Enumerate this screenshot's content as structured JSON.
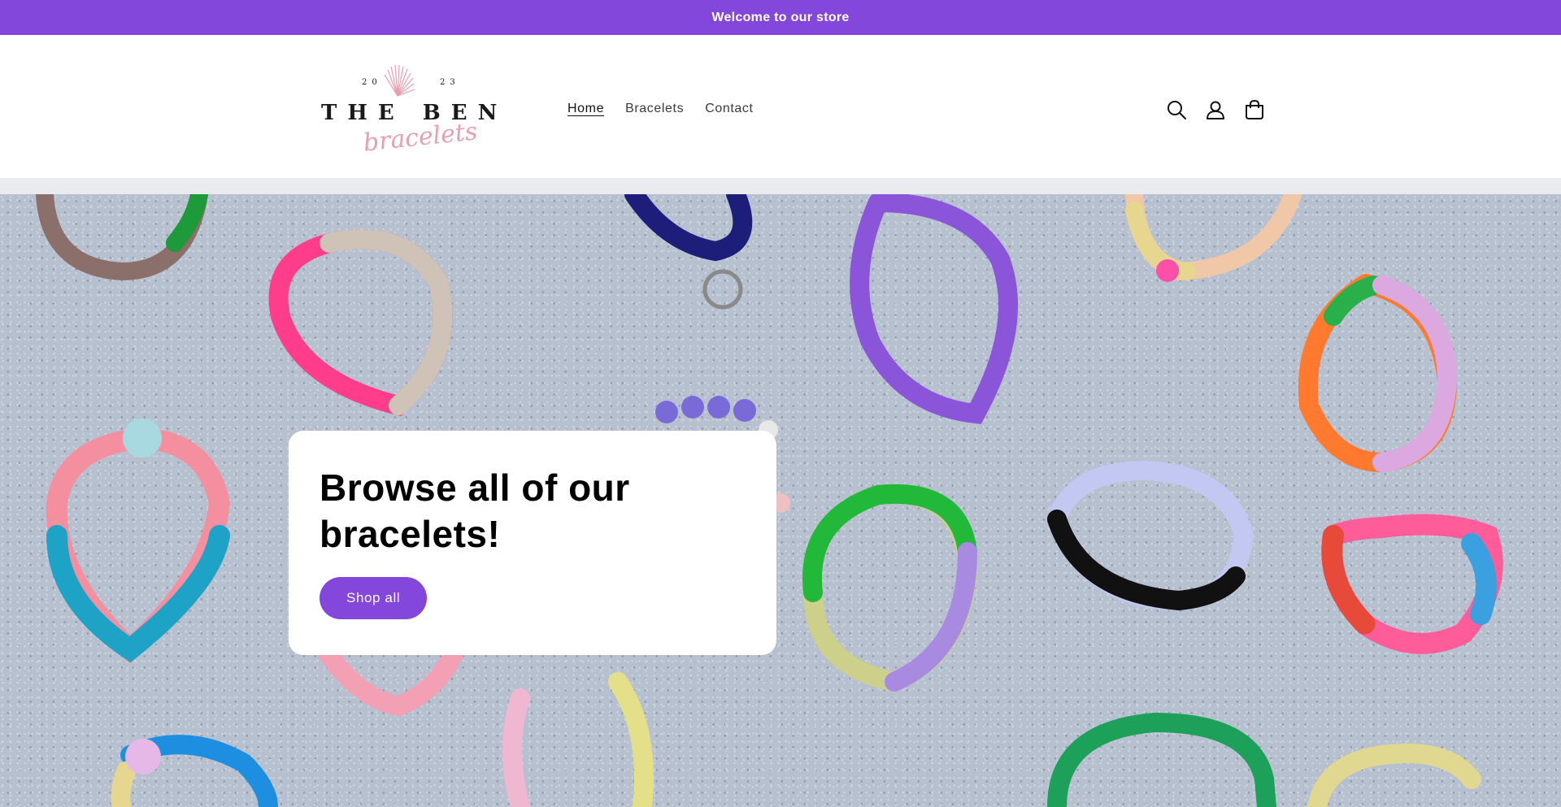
{
  "announcement": {
    "text": "Welcome to our store"
  },
  "brand": {
    "name": "THE BEND",
    "script": "bracelets",
    "year_left": "20",
    "year_right": "23"
  },
  "nav": {
    "items": [
      {
        "label": "Home",
        "active": true
      },
      {
        "label": "Bracelets",
        "active": false
      },
      {
        "label": "Contact",
        "active": false
      }
    ]
  },
  "header_icons": [
    "search-icon",
    "account-icon",
    "cart-icon"
  ],
  "hero": {
    "title": "Browse all of our bracelets!",
    "button_label": "Shop all"
  },
  "colors": {
    "accent": "#8447db",
    "announcement_bg": "#8447db",
    "logo_pink": "#e8a0b0",
    "logo_dark": "#1a1a1a",
    "hero_surface": "#b7c0cf"
  }
}
